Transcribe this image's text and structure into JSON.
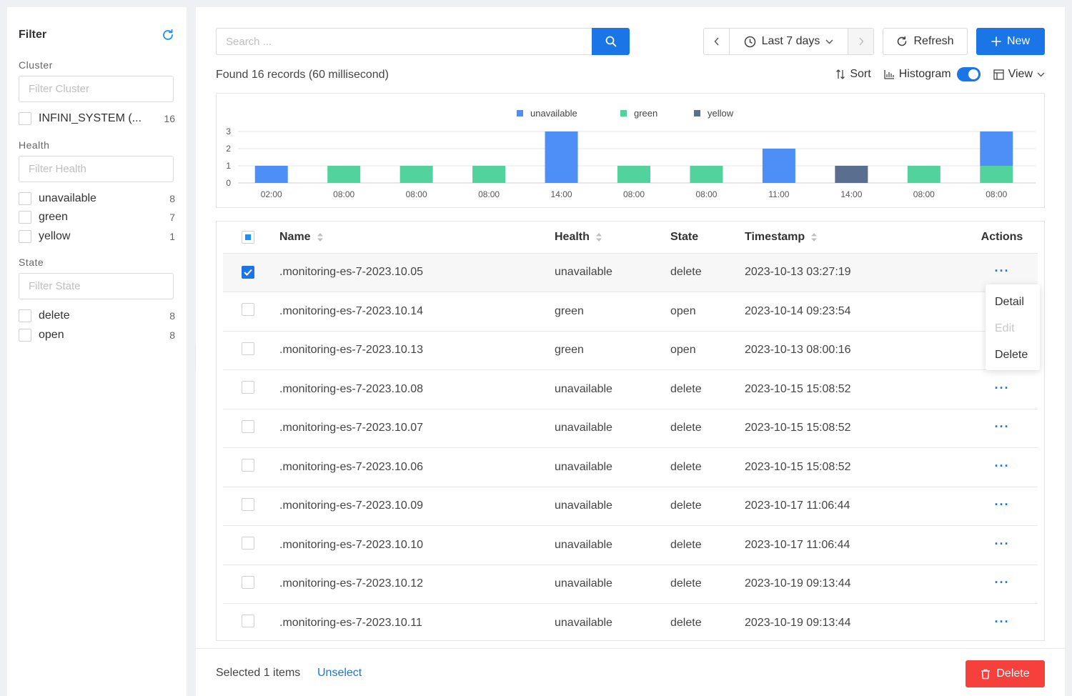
{
  "sidebar": {
    "title": "Filter",
    "sections": [
      {
        "title": "Cluster",
        "placeholder": "Filter Cluster",
        "options": [
          {
            "label": "INFINI_SYSTEM (...",
            "count": "16"
          }
        ]
      },
      {
        "title": "Health",
        "placeholder": "Filter Health",
        "options": [
          {
            "label": "unavailable",
            "count": "8"
          },
          {
            "label": "green",
            "count": "7"
          },
          {
            "label": "yellow",
            "count": "1"
          }
        ]
      },
      {
        "title": "State",
        "placeholder": "Filter State",
        "options": [
          {
            "label": "delete",
            "count": "8"
          },
          {
            "label": "open",
            "count": "8"
          }
        ]
      }
    ]
  },
  "toolbar": {
    "search_placeholder": "Search ...",
    "time_range": "Last 7 days",
    "refresh_label": "Refresh",
    "new_label": "New",
    "found_text": "Found 16 records (60 millisecond)",
    "sort_label": "Sort",
    "histogram_label": "Histogram",
    "view_label": "View"
  },
  "colors": {
    "unavailable": "#4e8ef7",
    "green": "#52d29c",
    "yellow": "#5a6f8f",
    "accent": "#1a76e6",
    "danger": "#f5403b"
  },
  "chart_data": {
    "type": "bar",
    "stacked": true,
    "categories": [
      "02:00",
      "08:00",
      "08:00",
      "08:00",
      "14:00",
      "08:00",
      "08:00",
      "11:00",
      "14:00",
      "08:00",
      "08:00"
    ],
    "series": [
      {
        "name": "unavailable",
        "values": [
          1,
          0,
          0,
          0,
          3,
          0,
          0,
          2,
          0,
          0,
          2
        ]
      },
      {
        "name": "green",
        "values": [
          0,
          1,
          1,
          1,
          0,
          1,
          1,
          0,
          0,
          1,
          1
        ]
      },
      {
        "name": "yellow",
        "values": [
          0,
          0,
          0,
          0,
          0,
          0,
          0,
          0,
          1,
          0,
          0
        ]
      }
    ],
    "ylim": [
      0,
      3
    ],
    "yticks": [
      "0",
      "1",
      "2",
      "3"
    ],
    "legend": "top-center",
    "grid": true
  },
  "table": {
    "headers": {
      "name": "Name",
      "health": "Health",
      "state": "State",
      "timestamp": "Timestamp",
      "actions": "Actions"
    },
    "rows": [
      {
        "name": ".monitoring-es-7-2023.10.05",
        "health": "unavailable",
        "state": "delete",
        "timestamp": "2023-10-13 03:27:19",
        "selected": true
      },
      {
        "name": ".monitoring-es-7-2023.10.14",
        "health": "green",
        "state": "open",
        "timestamp": "2023-10-14 09:23:54"
      },
      {
        "name": ".monitoring-es-7-2023.10.13",
        "health": "green",
        "state": "open",
        "timestamp": "2023-10-13 08:00:16"
      },
      {
        "name": ".monitoring-es-7-2023.10.08",
        "health": "unavailable",
        "state": "delete",
        "timestamp": "2023-10-15 15:08:52"
      },
      {
        "name": ".monitoring-es-7-2023.10.07",
        "health": "unavailable",
        "state": "delete",
        "timestamp": "2023-10-15 15:08:52"
      },
      {
        "name": ".monitoring-es-7-2023.10.06",
        "health": "unavailable",
        "state": "delete",
        "timestamp": "2023-10-15 15:08:52"
      },
      {
        "name": ".monitoring-es-7-2023.10.09",
        "health": "unavailable",
        "state": "delete",
        "timestamp": "2023-10-17 11:06:44"
      },
      {
        "name": ".monitoring-es-7-2023.10.10",
        "health": "unavailable",
        "state": "delete",
        "timestamp": "2023-10-17 11:06:44"
      },
      {
        "name": ".monitoring-es-7-2023.10.12",
        "health": "unavailable",
        "state": "delete",
        "timestamp": "2023-10-19 09:13:44"
      },
      {
        "name": ".monitoring-es-7-2023.10.11",
        "health": "unavailable",
        "state": "delete",
        "timestamp": "2023-10-19 09:13:44"
      }
    ]
  },
  "row_menu": {
    "items": [
      {
        "label": "Detail",
        "disabled": false
      },
      {
        "label": "Edit",
        "disabled": true
      },
      {
        "label": "Delete",
        "disabled": false
      }
    ]
  },
  "footer": {
    "selected_text": "Selected 1 items",
    "unselect_label": "Unselect",
    "delete_label": "Delete"
  }
}
